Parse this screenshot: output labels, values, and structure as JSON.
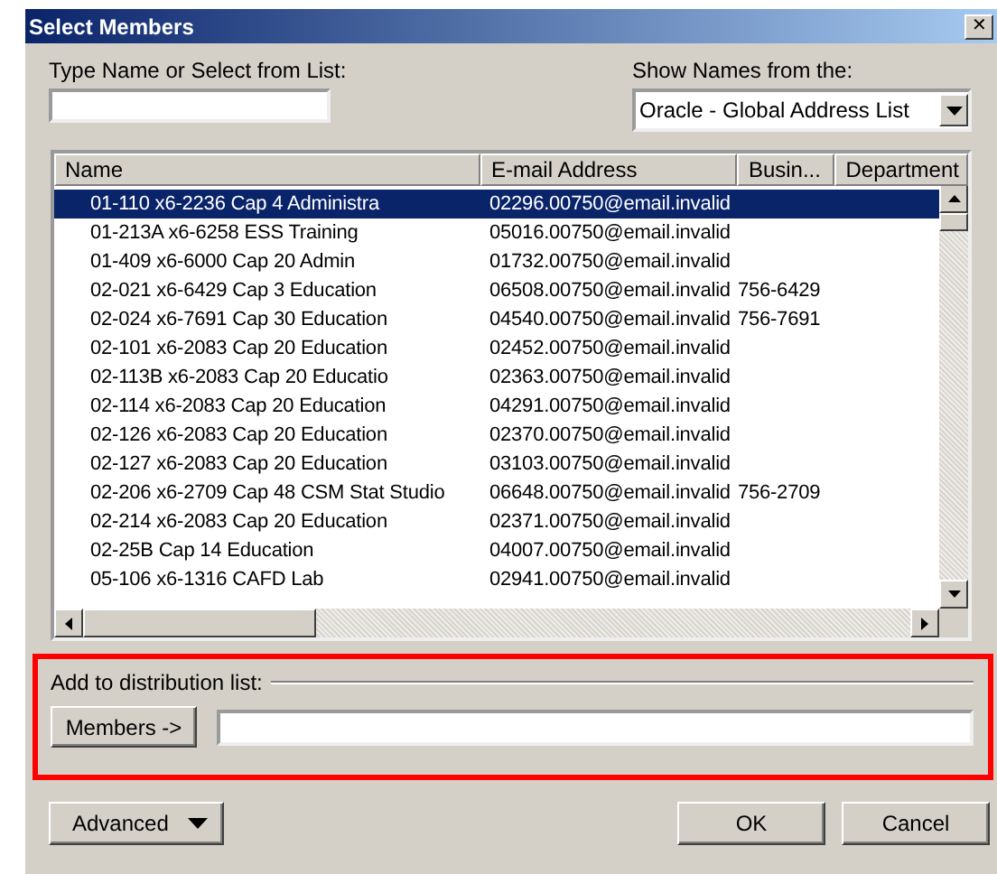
{
  "window": {
    "title": "Select Members",
    "close": "✕"
  },
  "search": {
    "label": "Type Name or Select from List:"
  },
  "address_book": {
    "label": "Show Names from the:",
    "value": "Oracle - Global Address List"
  },
  "table": {
    "columns": [
      "Name",
      "E-mail Address",
      "Busin...",
      "Department"
    ],
    "rows": [
      {
        "name": "01-110 x6-2236 Cap 4 Administra",
        "email": "02296.00750@email.invalid",
        "business": "",
        "selected": true
      },
      {
        "name": "01-213A x6-6258 ESS Training",
        "email": "05016.00750@email.invalid",
        "business": "",
        "selected": false
      },
      {
        "name": "01-409 x6-6000 Cap 20 Admin",
        "email": "01732.00750@email.invalid",
        "business": "",
        "selected": false
      },
      {
        "name": "02-021 x6-6429 Cap 3 Education",
        "email": "06508.00750@email.invalid",
        "business": "756-6429",
        "selected": false
      },
      {
        "name": "02-024 x6-7691 Cap 30 Education",
        "email": "04540.00750@email.invalid",
        "business": "756-7691",
        "selected": false
      },
      {
        "name": "02-101 x6-2083 Cap 20 Education",
        "email": "02452.00750@email.invalid",
        "business": "",
        "selected": false
      },
      {
        "name": "02-113B x6-2083 Cap 20 Educatio",
        "email": "02363.00750@email.invalid",
        "business": "",
        "selected": false
      },
      {
        "name": "02-114 x6-2083 Cap 20 Education",
        "email": "04291.00750@email.invalid",
        "business": "",
        "selected": false
      },
      {
        "name": "02-126 x6-2083 Cap 20 Education",
        "email": "02370.00750@email.invalid",
        "business": "",
        "selected": false
      },
      {
        "name": "02-127 x6-2083 Cap 20 Education",
        "email": "03103.00750@email.invalid",
        "business": "",
        "selected": false
      },
      {
        "name": "02-206 x6-2709 Cap 48 CSM Stat Studio",
        "email": "06648.00750@email.invalid",
        "business": "756-2709",
        "selected": false
      },
      {
        "name": "02-214 x6-2083 Cap 20 Education",
        "email": "02371.00750@email.invalid",
        "business": "",
        "selected": false
      },
      {
        "name": "02-25B Cap 14 Education",
        "email": "04007.00750@email.invalid",
        "business": "",
        "selected": false
      },
      {
        "name": "05-106 x6-1316 CAFD Lab",
        "email": "02941.00750@email.invalid",
        "business": "",
        "selected": false
      }
    ]
  },
  "distribution": {
    "label": "Add to distribution list:",
    "button": "Members ->"
  },
  "buttons": {
    "advanced": "Advanced",
    "ok": "OK",
    "cancel": "Cancel"
  }
}
